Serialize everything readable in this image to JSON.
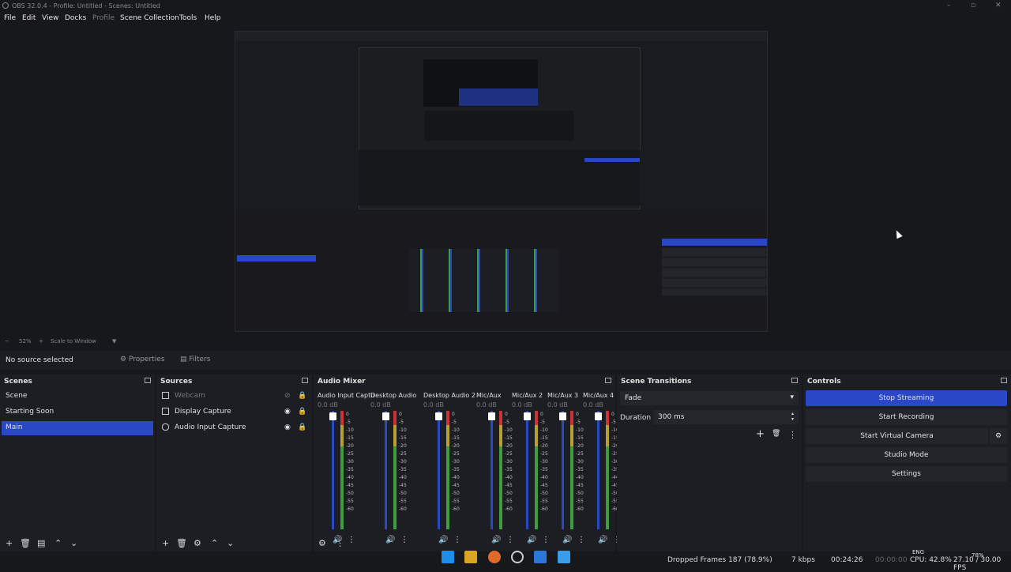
{
  "window": {
    "title": "OBS 32.0.4 - Profile: Untitled - Scenes: Untitled"
  },
  "menu": [
    {
      "label": "File"
    },
    {
      "label": "Edit"
    },
    {
      "label": "View"
    },
    {
      "label": "Docks"
    },
    {
      "label": "Profile"
    },
    {
      "label": "Scene Collection"
    },
    {
      "label": "Tools"
    },
    {
      "label": "Help"
    }
  ],
  "zoom": {
    "value": "52%",
    "mode": "Scale to Window"
  },
  "source_toolbar": {
    "status": "No source selected",
    "properties": "Properties",
    "filters": "Filters"
  },
  "scenes": {
    "title": "Scenes",
    "items": [
      {
        "label": "Scene"
      },
      {
        "label": "Starting Soon"
      },
      {
        "label": "Main"
      }
    ],
    "selected": "Main"
  },
  "sources": {
    "title": "Sources",
    "items": [
      {
        "label": "Webcam",
        "icon": "camera-icon",
        "visible": false
      },
      {
        "label": "Display Capture",
        "icon": "monitor-icon",
        "visible": true
      },
      {
        "label": "Audio Input Capture",
        "icon": "microphone-icon",
        "visible": true
      }
    ]
  },
  "mixer": {
    "title": "Audio Mixer",
    "channels": [
      {
        "name": "Audio Input Captur",
        "db": "0.0 dB"
      },
      {
        "name": "Desktop Audio",
        "db": "0.0 dB"
      },
      {
        "name": "Desktop Audio 2",
        "db": "0.0 dB"
      },
      {
        "name": "Mic/Aux",
        "db": "0.0 dB"
      },
      {
        "name": "Mic/Aux 2",
        "db": "0.0 dB"
      },
      {
        "name": "Mic/Aux 3",
        "db": "0.0 dB"
      },
      {
        "name": "Mic/Aux 4",
        "db": "0.0 dB"
      }
    ],
    "scale": [
      "0",
      "-5",
      "-10",
      "-15",
      "-20",
      "-25",
      "-30",
      "-35",
      "-40",
      "-45",
      "-50",
      "-55",
      "-60"
    ]
  },
  "transitions": {
    "title": "Scene Transitions",
    "selected": "Fade",
    "duration_label": "Duration",
    "duration_value": "300 ms"
  },
  "controls": {
    "title": "Controls",
    "stop_streaming": "Stop Streaming",
    "start_recording": "Start Recording",
    "start_virtual_camera": "Start Virtual Camera",
    "studio_mode": "Studio Mode",
    "settings": "Settings"
  },
  "statusbar": {
    "dropped_frames": "Dropped Frames 187 (78.9%)",
    "bitrate": "7 kbps",
    "stream_time": "00:24:26",
    "record_time": "00:00:00",
    "cpu": "CPU: 42.8%",
    "fps": "27.10 / 30.00 FPS",
    "lang": "ENG",
    "battery": "78%"
  },
  "colors": {
    "accent": "#2a47c8",
    "panel": "#1d1e23",
    "background": "#17181c"
  }
}
